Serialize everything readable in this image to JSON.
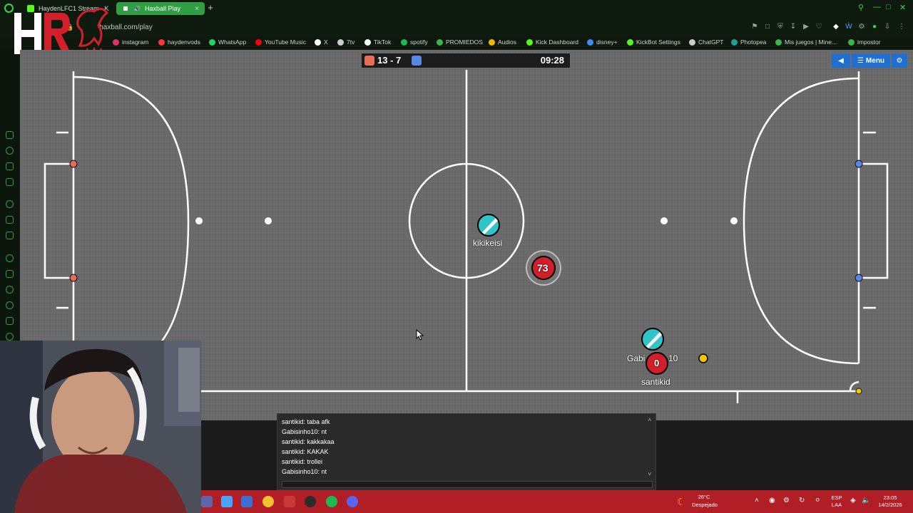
{
  "browser": {
    "tabs": [
      {
        "label": "HaydenLFC1 Stream - K",
        "active": false
      },
      {
        "label": "Haxball Play",
        "active": true
      }
    ],
    "url": "haxball.com/play",
    "new_tab": "+",
    "bookmarks": [
      {
        "label": "instagram",
        "color": "#e1306c"
      },
      {
        "label": "haydenvods",
        "color": "#ff3333"
      },
      {
        "label": "WhatsApp",
        "color": "#25d366"
      },
      {
        "label": "YouTube Music",
        "color": "#ff0000"
      },
      {
        "label": "X",
        "color": "#ffffff"
      },
      {
        "label": "7tv",
        "color": "#cccccc"
      },
      {
        "label": "TikTok",
        "color": "#ffffff"
      },
      {
        "label": "spotify",
        "color": "#1db954"
      },
      {
        "label": "PROMIEDOS",
        "color": "#3ab54a"
      },
      {
        "label": "Audios",
        "color": "#f5b400"
      },
      {
        "label": "Kick Dashboard",
        "color": "#53fc18"
      },
      {
        "label": "disney+",
        "color": "#3b8cff"
      },
      {
        "label": "KickBot Settings",
        "color": "#53fc18"
      },
      {
        "label": "ChatGPT",
        "color": "#cccccc"
      },
      {
        "label": "Photopea",
        "color": "#18a497"
      },
      {
        "label": "Mis juegos | Mine...",
        "color": "#3ab54a"
      },
      {
        "label": "impostor",
        "color": "#3ab54a"
      }
    ]
  },
  "game": {
    "score_red": 13,
    "score_blue": 7,
    "score_text": "13 - 7",
    "clock": "09:28",
    "menu_label": "Menu",
    "players": [
      {
        "name": "kikikeisi",
        "team": "blue"
      },
      {
        "name": "",
        "number": "73",
        "team": "red"
      },
      {
        "name": "Gabisinho10",
        "team": "blue"
      },
      {
        "name": "santikid",
        "number": "0",
        "team": "red"
      }
    ],
    "name_kikikeisi": "kikikeisi",
    "name_gabi": "Gabi",
    "name_gabi_tail": "10",
    "name_santikid": "santikid",
    "number_73": "73",
    "number_0": "0",
    "colors": {
      "red_team": "#e56e56",
      "blue_team": "#5689e5",
      "pitch": "#6a6a6a",
      "ball": "#f5c400"
    }
  },
  "chat": {
    "messages": [
      "santikid: taba afk",
      "Gabisinho10: nt",
      "santikid: kakkakaa",
      "santikid: KAKAK",
      "santikid: trollei",
      "Gabisinho10: nt"
    ]
  },
  "taskbar": {
    "weather_temp": "26°C",
    "weather_desc": "Despejado",
    "lang_1": "ESP",
    "lang_2": "LAA",
    "time": "23:05",
    "date": "14/2/2026"
  }
}
